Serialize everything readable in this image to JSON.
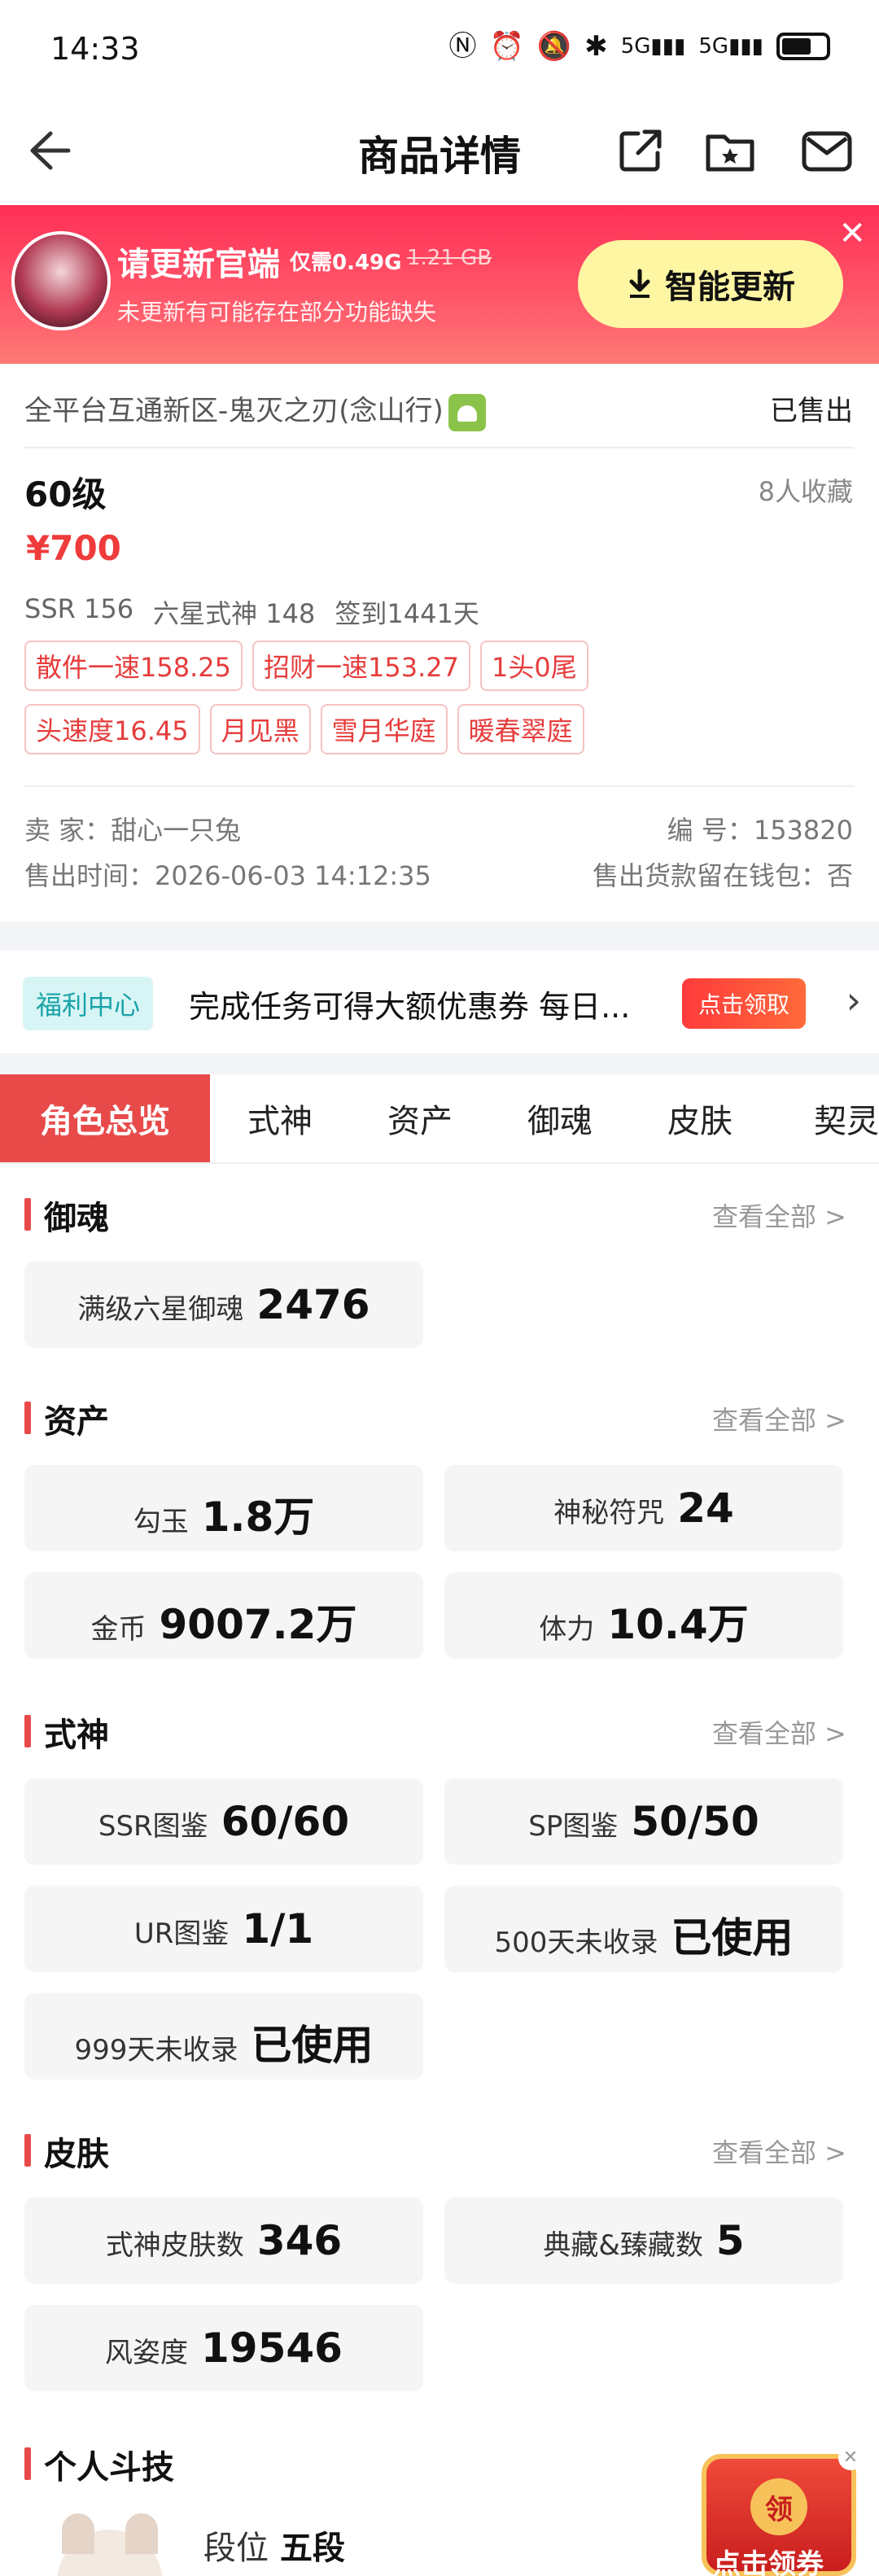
{
  "status_bar": {
    "time": "14:33",
    "network": "5G"
  },
  "nav": {
    "title": "商品详情"
  },
  "update_banner": {
    "title": "请更新官端",
    "size_new": "仅需0.49G",
    "size_old": "1.21 GB",
    "subtitle": "未更新有可能存在部分功能缺失",
    "button": "智能更新"
  },
  "product": {
    "server": "全平台互通新区-鬼灭之刃(念山行)",
    "status": "已售出",
    "level": "60级",
    "favorites": "8人收藏",
    "price": "¥700",
    "specs": [
      "SSR 156",
      "六星式神 148",
      "签到1441天"
    ],
    "tags": [
      "散件一速158.25",
      "招财一速153.27",
      "1头0尾",
      "头速度16.45",
      "月见黑",
      "雪月华庭",
      "暖春翠庭"
    ],
    "seller": "卖 家：甜心一只兔",
    "id": "编 号：153820",
    "sold_time": "售出时间：2026-06-03 14:12:35",
    "wallet": "售出货款留在钱包：否"
  },
  "welfare": {
    "tag": "福利中心",
    "text": "完成任务可得大额优惠券  每日...",
    "button": "点击领取"
  },
  "tabs": [
    "角色总览",
    "式神",
    "资产",
    "御魂",
    "皮肤",
    "契灵"
  ],
  "sections": {
    "yuhun": {
      "title": "御魂",
      "more": "查看全部 >",
      "items": [
        {
          "label": "满级六星御魂",
          "value": "2476"
        }
      ]
    },
    "assets": {
      "title": "资产",
      "more": "查看全部 >",
      "items": [
        {
          "label": "勾玉",
          "value": "1.8万"
        },
        {
          "label": "神秘符咒",
          "value": "24"
        },
        {
          "label": "金币",
          "value": "9007.2万"
        },
        {
          "label": "体力",
          "value": "10.4万"
        }
      ]
    },
    "shikigami": {
      "title": "式神",
      "more": "查看全部 >",
      "items": [
        {
          "label": "SSR图鉴",
          "value": "60/60"
        },
        {
          "label": "SP图鉴",
          "value": "50/50"
        },
        {
          "label": "UR图鉴",
          "value": "1/1"
        },
        {
          "label": "500天未收录",
          "value": "已使用"
        },
        {
          "label": "999天未收录",
          "value": "已使用"
        }
      ]
    },
    "skins": {
      "title": "皮肤",
      "more": "查看全部 >",
      "items": [
        {
          "label": "式神皮肤数",
          "value": "346"
        },
        {
          "label": "典藏&臻藏数",
          "value": "5"
        },
        {
          "label": "风姿度",
          "value": "19546"
        }
      ]
    },
    "pvp": {
      "title": "个人斗技",
      "rank_label": "段位",
      "rank_value": "五段"
    }
  },
  "float_gift": {
    "coin": "领",
    "label": "点击领券"
  }
}
